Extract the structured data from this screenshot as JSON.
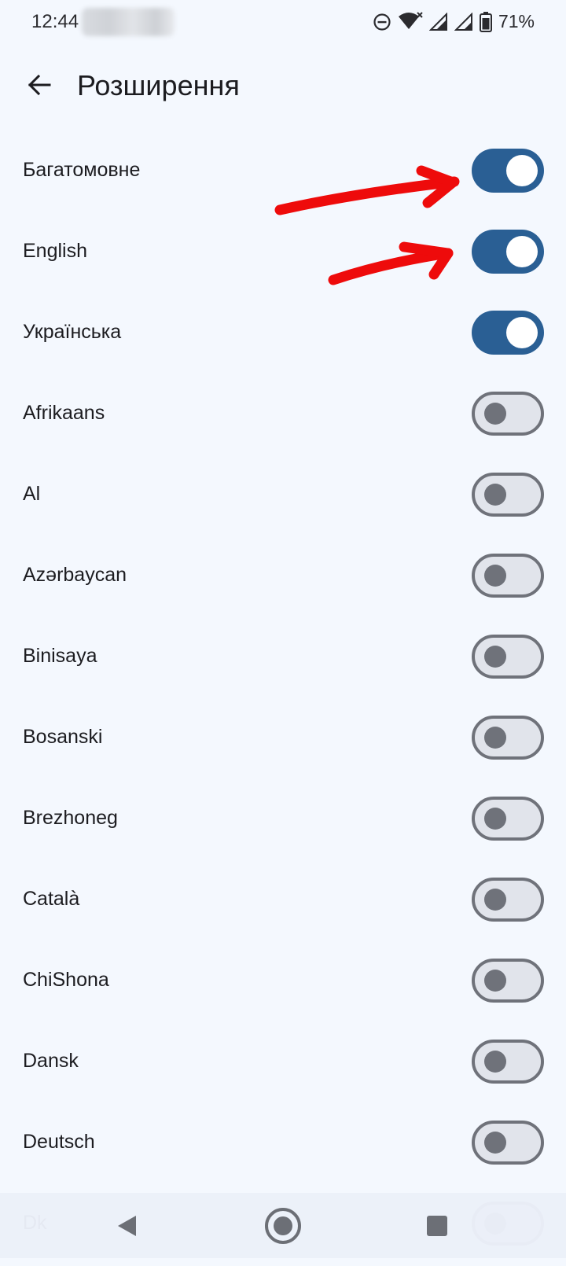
{
  "status_bar": {
    "time": "12:44",
    "battery_percent": "71%",
    "icons": [
      "do-not-disturb-icon",
      "wifi-icon",
      "signal-icon",
      "signal-icon",
      "battery-icon"
    ]
  },
  "header": {
    "title": "Розширення",
    "back_icon": "arrow-left-icon"
  },
  "languages": [
    {
      "label": "Багатомовне",
      "enabled": true
    },
    {
      "label": "English",
      "enabled": true
    },
    {
      "label": "Українська",
      "enabled": true
    },
    {
      "label": "Afrikaans",
      "enabled": false
    },
    {
      "label": "Al",
      "enabled": false
    },
    {
      "label": "Azərbaycan",
      "enabled": false
    },
    {
      "label": "Binisaya",
      "enabled": false
    },
    {
      "label": "Bosanski",
      "enabled": false
    },
    {
      "label": "Brezhoneg",
      "enabled": false
    },
    {
      "label": "Català",
      "enabled": false
    },
    {
      "label": "ChiShona",
      "enabled": false
    },
    {
      "label": "Dansk",
      "enabled": false
    },
    {
      "label": "Deutsch",
      "enabled": false
    },
    {
      "label": "Dk",
      "enabled": false
    }
  ],
  "colors": {
    "background": "#f4f8fe",
    "switch_on": "#2a5f94",
    "switch_off_track": "#e1e4eb",
    "switch_off_outline": "#6f727a",
    "annotation_arrow": "#ee0b0b"
  },
  "nav_bar": {
    "icons": [
      "nav-back-icon",
      "nav-home-icon",
      "nav-recents-icon"
    ]
  }
}
